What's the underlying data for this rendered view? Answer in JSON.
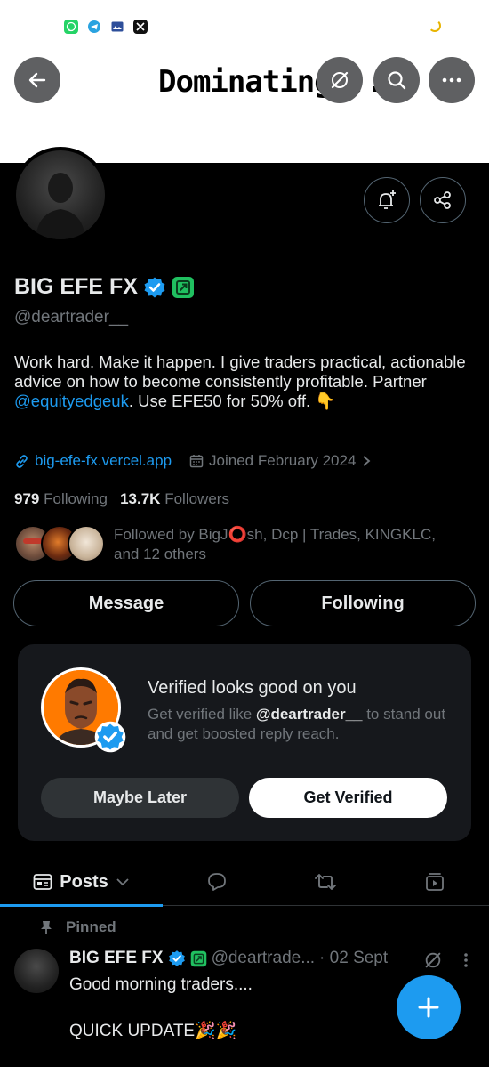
{
  "status_bar": {
    "icons": [
      "whatsapp-icon",
      "telegram-icon",
      "gallery-icon",
      "x-app-icon"
    ],
    "loading_indicator": "loading-spinner-icon"
  },
  "header": {
    "banner_text": "Dominating...",
    "buttons": [
      "back-arrow-icon",
      "grok-icon",
      "search-icon",
      "more-icon"
    ]
  },
  "profile": {
    "display_name": "BIG EFE FX",
    "handle": "@deartrader__",
    "bio_before": "Work hard. Make it happen. I give traders practical, actionable advice on how to become consistently profitable. Partner ",
    "bio_mention": "@equityedgeuk",
    "bio_after": ". Use EFE50 for 50% off. 👇",
    "website": "big-efe-fx.vercel.app",
    "joined": "Joined February 2024",
    "following_count": "979",
    "following_label": "Following",
    "followers_count": "13.7K",
    "followers_label": "Followers",
    "followed_by": "Followed by BigJ⭕sh, Dcp | Trades, KINGKLC, and 12 others",
    "message_button": "Message",
    "following_button": "Following",
    "colors": {
      "accent": "#1d9bf0",
      "verified_badge": "#1d9bf0",
      "affiliate_badge": "#20c060"
    }
  },
  "verified_card": {
    "title": "Verified looks good on you",
    "desc_before": "Get verified like ",
    "desc_handle": "@deartrader__",
    "desc_after": " to stand out and get boosted reply reach.",
    "maybe_later": "Maybe Later",
    "get_verified": "Get Verified"
  },
  "tabs": {
    "posts_label": "Posts",
    "items": [
      "posts-icon",
      "replies-icon",
      "reposts-icon",
      "media-icon"
    ]
  },
  "post": {
    "pinned_label": "Pinned",
    "author": "BIG EFE FX",
    "handle": "@deartrade...",
    "date": "· 02 Sept",
    "line1": "Good morning traders....",
    "line2": "QUICK UPDATE🎉🎉"
  }
}
